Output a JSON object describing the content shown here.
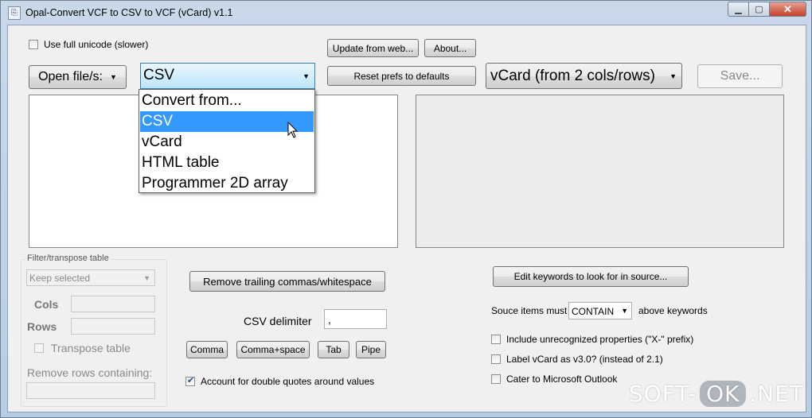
{
  "window": {
    "title": "Opal-Convert VCF to CSV to VCF (vCard) v1.1",
    "minimize_glyph": "▁",
    "maximize_glyph": "▢",
    "close_glyph": "✕"
  },
  "top": {
    "unicode_label": "Use full unicode (slower)",
    "update_label": "Update from web...",
    "about_label": "About...",
    "open_label": "Open file/s:",
    "reset_label": "Reset prefs to defaults",
    "save_label": "Save..."
  },
  "from_combo": {
    "value": "CSV",
    "options": [
      "Convert from...",
      "CSV",
      "vCard",
      "HTML table",
      "Programmer 2D array"
    ],
    "selected_index": 1
  },
  "to_combo": {
    "value": "vCard (from 2 cols/rows)"
  },
  "filter": {
    "group_label": "Filter/transpose table",
    "select_value": "Keep selected",
    "cols_label": "Cols",
    "rows_label": "Rows",
    "transpose_label": "Transpose table",
    "remove_rows_label": "Remove rows containing:"
  },
  "csv": {
    "remove_trailing_label": "Remove trailing commas/whitespace",
    "delimiter_label": "CSV delimiter",
    "delimiter_value": ",",
    "comma_label": "Comma",
    "comma_space_label": "Comma+space",
    "tab_label": "Tab",
    "pipe_label": "Pipe",
    "quotes_label": "Account for double quotes around values",
    "quotes_checked": true
  },
  "vcard": {
    "edit_keywords_label": "Edit keywords to look for in source...",
    "source_prefix": "Souce items must",
    "contain_value": "CONTAIN",
    "source_suffix": "above keywords",
    "include_x_label": "Include unrecognized properties (\"X-\" prefix)",
    "label_v3_label": "Label vCard as v3.0? (instead of 2.1)",
    "outlook_label": "Cater to Microsoft Outlook"
  },
  "watermark": {
    "left": "SOFT-",
    "mid": "OK",
    "right": ".NET"
  }
}
